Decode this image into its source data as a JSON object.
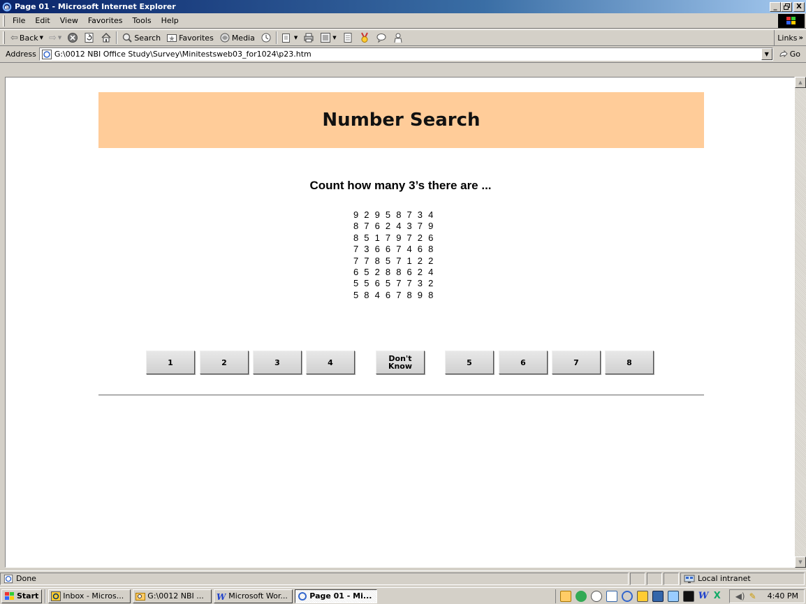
{
  "window": {
    "title": "Page 01 - Microsoft Internet Explorer",
    "minimize": "_",
    "maximize": "ð",
    "close": "X"
  },
  "menu": [
    "File",
    "Edit",
    "View",
    "Favorites",
    "Tools",
    "Help"
  ],
  "toolbar": {
    "back": "Back",
    "search": "Search",
    "favorites": "Favorites",
    "media": "Media",
    "links": "Links"
  },
  "address": {
    "label": "Address",
    "value": "G:\\0012 NBI Office Study\\Survey\\Minitestsweb03_for1024\\p23.htm",
    "go": "Go"
  },
  "page": {
    "banner_title": "Number Search",
    "instruction": "Count how many 3’s there are ...",
    "grid": [
      [
        "9",
        "2",
        "9",
        "5",
        "8",
        "7",
        "3",
        "4"
      ],
      [
        "8",
        "7",
        "6",
        "2",
        "4",
        "3",
        "7",
        "9"
      ],
      [
        "8",
        "5",
        "1",
        "7",
        "9",
        "7",
        "2",
        "6"
      ],
      [
        "7",
        "3",
        "6",
        "6",
        "7",
        "4",
        "6",
        "8"
      ],
      [
        "7",
        "7",
        "8",
        "5",
        "7",
        "1",
        "2",
        "2"
      ],
      [
        "6",
        "5",
        "2",
        "8",
        "8",
        "6",
        "2",
        "4"
      ],
      [
        "5",
        "5",
        "6",
        "5",
        "7",
        "7",
        "3",
        "2"
      ],
      [
        "5",
        "8",
        "4",
        "6",
        "7",
        "8",
        "9",
        "8"
      ]
    ],
    "answers": [
      "1",
      "2",
      "3",
      "4",
      "Don't Know",
      "5",
      "6",
      "7",
      "8"
    ]
  },
  "status": {
    "text": "Done",
    "zone": "Local intranet"
  },
  "taskbar": {
    "start": "Start",
    "tasks": [
      {
        "label": "Inbox - Micros...",
        "active": false
      },
      {
        "label": "G:\\0012 NBI ...",
        "active": false
      },
      {
        "label": "Microsoft Wor...",
        "active": false
      },
      {
        "label": "Page 01 - Mi...",
        "active": true
      }
    ],
    "clock": "4:40 PM"
  },
  "colors": {
    "banner": "#ffcc99",
    "titlebar_start": "#0a246a",
    "titlebar_end": "#a6caf0"
  }
}
